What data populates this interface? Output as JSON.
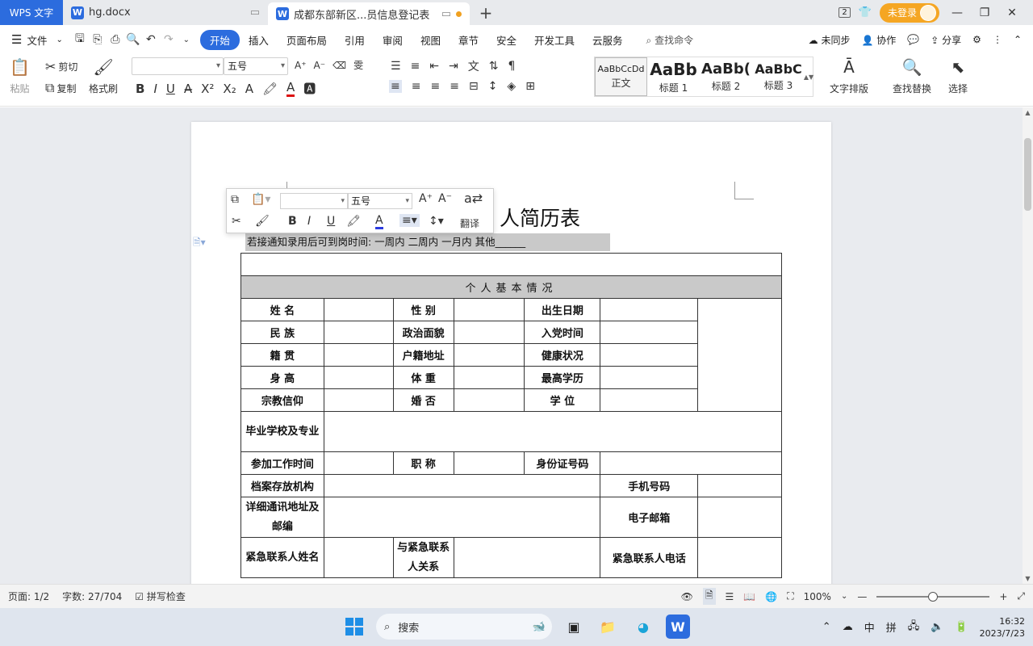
{
  "tabs": {
    "app": "WPS 文字",
    "doc1": "hg.docx",
    "doc2": "成都东部新区...员信息登记表",
    "w_letter": "W",
    "plus": "+",
    "page_badge": "2",
    "login": "未登录"
  },
  "menu": {
    "file": "文件",
    "items": [
      "开始",
      "插入",
      "页面布局",
      "引用",
      "审阅",
      "视图",
      "章节",
      "安全",
      "开发工具",
      "云服务"
    ],
    "search": "查找命令",
    "sync": "未同步",
    "collab": "协作",
    "share": "分享"
  },
  "ribbon": {
    "paste": "粘贴",
    "cut": "剪切",
    "copy": "复制",
    "format_painter": "格式刷",
    "font_name": "",
    "font_size": "五号",
    "styles": [
      {
        "sample": "AaBbCcDd",
        "label": "正文"
      },
      {
        "sample": "AaBb",
        "label": "标题 1"
      },
      {
        "sample": "AaBb(",
        "label": "标题 2"
      },
      {
        "sample": "AaBbC",
        "label": "标题 3"
      }
    ],
    "text_layout": "文字排版",
    "find_replace": "查找替换",
    "select": "选择"
  },
  "mini_toolbar": {
    "font_size": "五号",
    "translate": "翻译"
  },
  "document": {
    "title_visible": "人简历表",
    "notice": "若接通知录用后可到岗时间:  一周内   二周内   一月内  其他______",
    "section_header": "个人基本情况",
    "rows": [
      [
        "姓    名",
        "",
        "性    别",
        "",
        "出生日期",
        ""
      ],
      [
        "民    族",
        "",
        "政治面貌",
        "",
        "入党时间",
        ""
      ],
      [
        "籍    贯",
        "",
        "户籍地址",
        "",
        "健康状况",
        ""
      ],
      [
        "身    高",
        "",
        "体    重",
        "",
        "最高学历",
        ""
      ],
      [
        "宗教信仰",
        "",
        "婚    否",
        "",
        "学    位",
        ""
      ]
    ],
    "grad_school": "毕业学校及专业",
    "work_start": "参加工作时间",
    "job_title": "职    称",
    "id_number": "身份证号码",
    "archive": "档案存放机构",
    "mobile": "手机号码",
    "address": "详细通讯地址及邮编",
    "email": "电子邮箱",
    "emergency": "紧急联系人姓名",
    "relation": "与紧急联系人关系",
    "emergency_phone": "紧急联系人电话"
  },
  "status": {
    "page": "页面: 1/2",
    "words": "字数: 27/704",
    "spell": "拼写检查",
    "zoom": "100%"
  },
  "taskbar": {
    "search": "搜索",
    "ime_zh": "中",
    "ime_pin": "拼",
    "time": "16:32",
    "date": "2023/7/23"
  },
  "colors": {
    "accent": "#2c6cde",
    "login": "#f5a623",
    "header_fill": "#c9c9c9"
  }
}
